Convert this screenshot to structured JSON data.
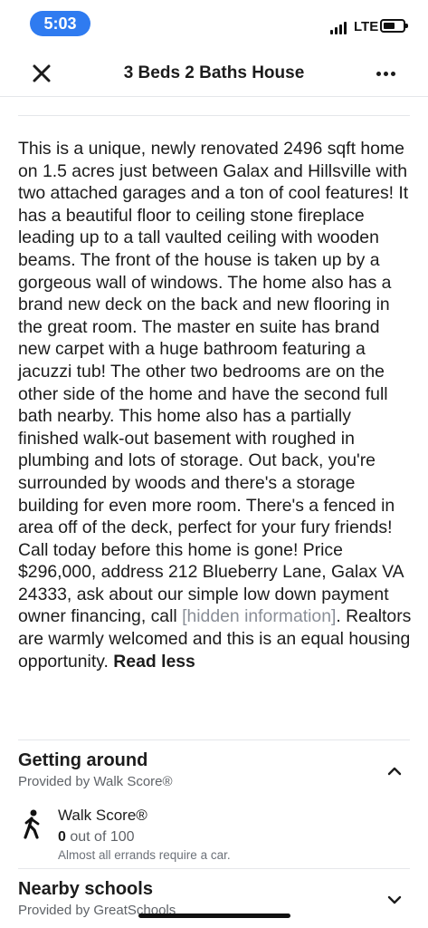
{
  "status_bar": {
    "time": "5:03",
    "network": "LTE",
    "time_pill_color": "#2f7bf0"
  },
  "header": {
    "title": "3 Beds 2 Baths House",
    "close_icon": "close-icon",
    "more_icon": "more-horizontal-icon"
  },
  "description": {
    "text_before": "This is a unique, newly renovated 2496 sqft home on 1.5 acres just between Galax and Hillsville with two attached garages and a ton of cool features! It has a beautiful floor to ceiling stone fireplace leading up to a tall vaulted ceiling with wooden beams. The front of the house is taken up by a gorgeous wall of windows. The home also has a brand new deck on the back and new flooring in the great room. The master en suite has brand new carpet with a huge bathroom featuring a jacuzzi tub! The other two bedrooms are on the other side of the home and have the second full bath nearby. This home also has a partially finished walk-out basement with roughed in plumbing and lots of storage. Out back, you're surrounded by woods and there's a storage building for even more room. There's a fenced in area off of the deck, perfect for your fury friends! Call today before this home is gone! Price $296,000, address 212 Blueberry Lane, Galax VA 24333, ask about our simple low down payment owner financing, call ",
    "hidden": "[hidden information]",
    "text_after": ". Realtors are warmly welcomed and this is an equal housing opportunity. ",
    "read_less": "Read less"
  },
  "getting_around": {
    "title": "Getting around",
    "provider": "Provided by Walk Score®",
    "expanded": true,
    "walk_score": {
      "label": "Walk Score®",
      "score": "0",
      "out_of": " out of 100",
      "note": "Almost all errands require a car.",
      "icon": "walking-person-icon"
    }
  },
  "nearby_schools": {
    "title": "Nearby schools",
    "provider": "Provided by GreatSchools",
    "expanded": false
  }
}
